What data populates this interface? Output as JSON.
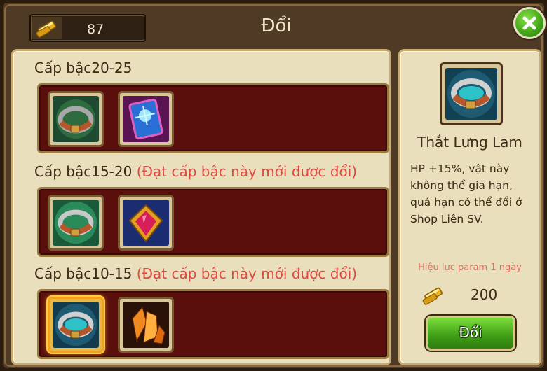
{
  "header": {
    "title": "Đổi",
    "currency_amount": "87",
    "currency_icon": "gold-bar-icon"
  },
  "tiers": [
    {
      "label": "Cấp bậc20-25",
      "requirement": "",
      "items": [
        "belt-icon",
        "rune-card-icon"
      ]
    },
    {
      "label": "Cấp bậc15-20",
      "requirement": "(Đạt cấp bậc này mới được đổi)",
      "items": [
        "teal-belt-icon",
        "ruby-amulet-icon"
      ]
    },
    {
      "label": "Cấp bậc10-15",
      "requirement": "(Đạt cấp bậc này mới được đổi)",
      "items": [
        "blue-belt-icon",
        "amber-crystal-icon"
      ]
    }
  ],
  "detail": {
    "item_name": "Thắt Lưng Lam",
    "description": "HP +15%, vật này không thể gia hạn, quá hạn có thể đổi ở Shop Liên SV.",
    "validity": "Hiệu lực param 1 ngày",
    "price": "200",
    "exchange_button": "Đổi"
  },
  "colors": {
    "panel_bg": "#eadfbd",
    "row_bg": "#5a0f0c",
    "requirement_text": "#e0473e",
    "button_green": "#46a81a"
  }
}
